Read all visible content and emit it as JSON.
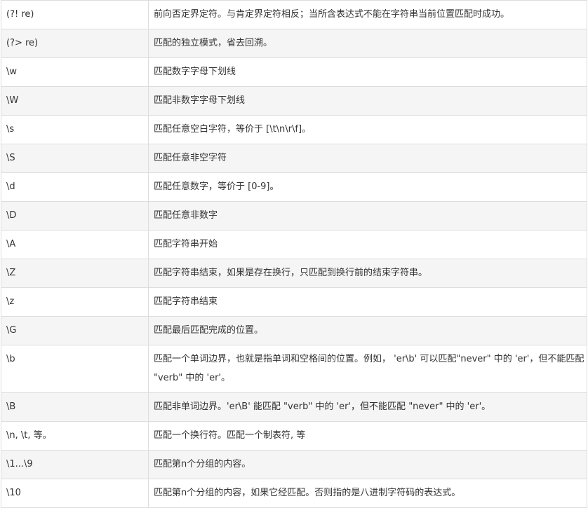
{
  "table": {
    "rows": [
      {
        "pattern": "(?! re)",
        "description": "前向否定界定符。与肯定界定符相反；当所含表达式不能在字符串当前位置匹配时成功。"
      },
      {
        "pattern": "(?> re)",
        "description": "匹配的独立模式，省去回溯。"
      },
      {
        "pattern": "\\w",
        "description": "匹配数字字母下划线"
      },
      {
        "pattern": "\\W",
        "description": "匹配非数字字母下划线"
      },
      {
        "pattern": "\\s",
        "description": "匹配任意空白字符，等价于 [\\t\\n\\r\\f]。"
      },
      {
        "pattern": "\\S",
        "description": "匹配任意非空字符"
      },
      {
        "pattern": "\\d",
        "description": "匹配任意数字，等价于 [0-9]。"
      },
      {
        "pattern": "\\D",
        "description": "匹配任意非数字"
      },
      {
        "pattern": "\\A",
        "description": "匹配字符串开始"
      },
      {
        "pattern": "\\Z",
        "description": "匹配字符串结束，如果是存在换行，只匹配到换行前的结束字符串。"
      },
      {
        "pattern": "\\z",
        "description": "匹配字符串结束"
      },
      {
        "pattern": "\\G",
        "description": "匹配最后匹配完成的位置。"
      },
      {
        "pattern": "\\b",
        "description": "匹配一个单词边界，也就是指单词和空格间的位置。例如， 'er\\b' 可以匹配\"never\" 中的 'er'，但不能匹配 \"verb\" 中的 'er'。"
      },
      {
        "pattern": "\\B",
        "description": "匹配非单词边界。'er\\B' 能匹配 \"verb\" 中的 'er'，但不能匹配 \"never\" 中的 'er'。"
      },
      {
        "pattern": "\\n, \\t, 等。",
        "description": "匹配一个换行符。匹配一个制表符, 等"
      },
      {
        "pattern": "\\1...\\9",
        "description": "匹配第n个分组的内容。"
      },
      {
        "pattern": "\\10",
        "description": "匹配第n个分组的内容，如果它经匹配。否则指的是八进制字符码的表达式。"
      }
    ]
  }
}
